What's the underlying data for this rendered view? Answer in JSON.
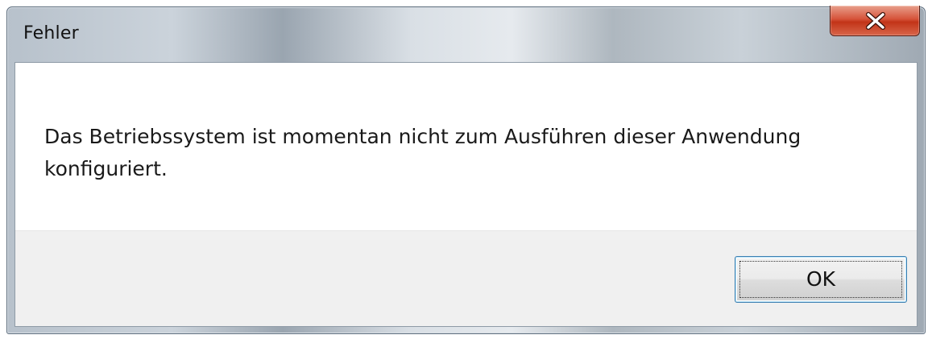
{
  "window": {
    "title": "Fehler",
    "close_icon": "close-icon",
    "close_color": "#c8391c"
  },
  "message": {
    "text": "Das Betriebssystem ist momentan nicht zum Ausführen dieser Anwendung konfiguriert."
  },
  "buttons": {
    "ok_label": "OK"
  }
}
